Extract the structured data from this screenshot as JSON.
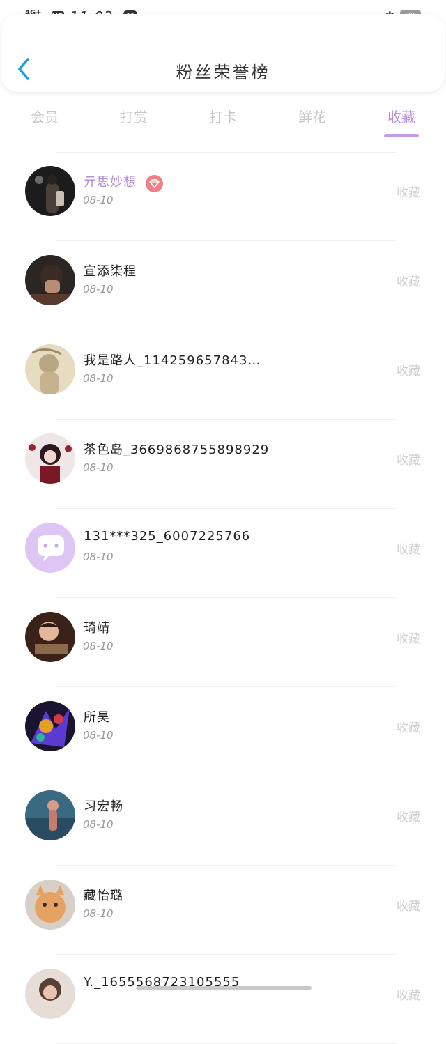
{
  "status_bar": {
    "network": "4G+",
    "hd": "HD",
    "time": "11:03",
    "battery": "29"
  },
  "header": {
    "title": "粉丝荣誉榜"
  },
  "tabs": [
    {
      "label": "会员",
      "active": false
    },
    {
      "label": "打赏",
      "active": false
    },
    {
      "label": "打卡",
      "active": false
    },
    {
      "label": "鲜花",
      "active": false
    },
    {
      "label": "收藏",
      "active": true
    }
  ],
  "list": {
    "items": [
      {
        "name": "亓思妙想",
        "date": "08-10",
        "action": "收藏",
        "highlight": true,
        "badge": "diamond-icon"
      },
      {
        "name": "宣添柒程",
        "date": "08-10",
        "action": "收藏"
      },
      {
        "name": "我是路人_114259657843…",
        "date": "08-10",
        "action": "收藏"
      },
      {
        "name": "茶色岛_3669868755898929",
        "date": "08-10",
        "action": "收藏"
      },
      {
        "name": "131***325_6007225766",
        "date": "08-10",
        "action": "收藏"
      },
      {
        "name": "琦靖",
        "date": "08-10",
        "action": "收藏"
      },
      {
        "name": "所昊",
        "date": "08-10",
        "action": "收藏"
      },
      {
        "name": "习宏畅",
        "date": "08-10",
        "action": "收藏"
      },
      {
        "name": "藏怡璐",
        "date": "08-10",
        "action": "收藏"
      },
      {
        "name": "Y._1655568723105555",
        "date": "",
        "action": "收藏"
      }
    ]
  },
  "colors": {
    "accent": "#b78fe0",
    "back_arrow": "#1e9be0",
    "badge": "#f07f86"
  }
}
